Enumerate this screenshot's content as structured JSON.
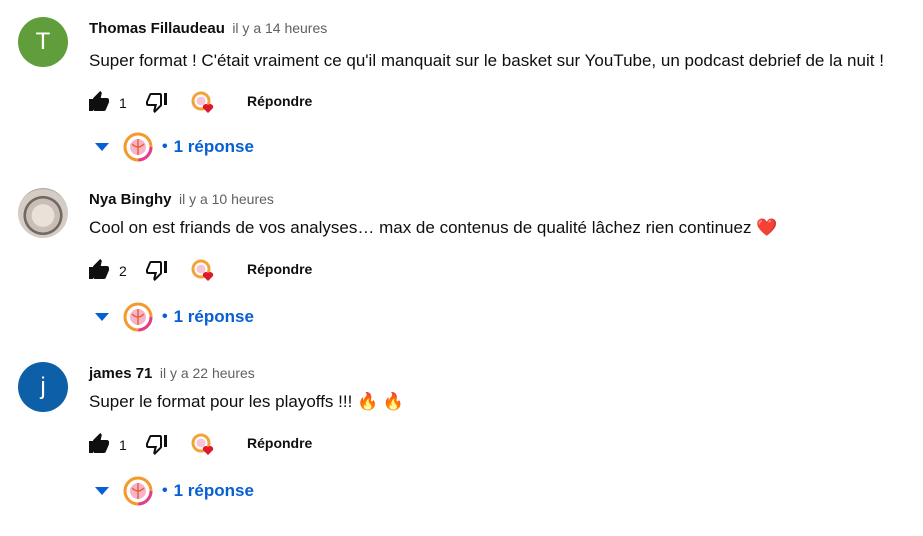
{
  "comments": [
    {
      "author": "Thomas Fillaudeau",
      "time": "il y a 14 heures",
      "text": "Super format ! C'était vraiment ce qu'il manquait sur le basket sur YouTube, un podcast debrief de la nuit !",
      "likes": "1",
      "reply_label": "Répondre",
      "replies_label": "1 réponse",
      "avatar_letter": "T",
      "avatar_color": "#5f9e3a"
    },
    {
      "author": "Nya Binghy",
      "time": "il y a 10 heures",
      "text": "Cool on est friands de vos analyses… max de contenus de qualité lâchez rien continuez ❤️",
      "likes": "2",
      "reply_label": "Répondre",
      "replies_label": "1 réponse",
      "avatar_letter": "",
      "avatar_color": "#cfc6bd"
    },
    {
      "author": "james 71",
      "time": "il y a 22 heures",
      "text": "Super le format pour les playoffs !!! 🔥 🔥",
      "likes": "1",
      "reply_label": "Répondre",
      "replies_label": "1 réponse",
      "avatar_letter": "j",
      "avatar_color": "#0d5fa8"
    }
  ],
  "colors": {
    "link_blue": "#065fd4",
    "text_primary": "#0f0f0f",
    "text_secondary": "#606060",
    "heart_red": "#e0182d"
  }
}
